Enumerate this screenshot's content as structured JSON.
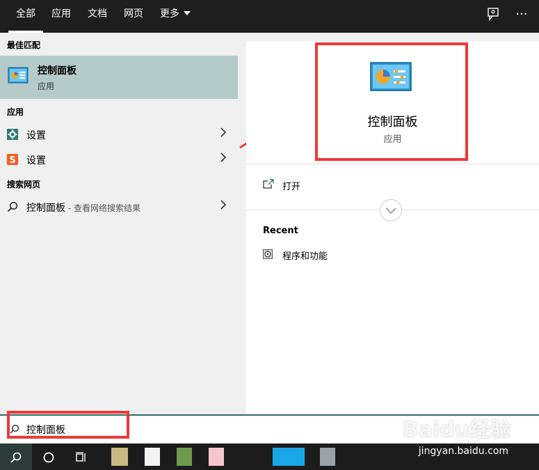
{
  "tabs": [
    {
      "label": "全部",
      "active": true
    },
    {
      "label": "应用"
    },
    {
      "label": "文档"
    },
    {
      "label": "网页"
    },
    {
      "label": "更多"
    }
  ],
  "top_icons": {
    "feedback": "feedback-icon",
    "more": "···"
  },
  "left": {
    "best_match_header": "最佳匹配",
    "best_match": {
      "name": "控制面板",
      "type": "应用",
      "icon": "control-panel-icon"
    },
    "apps_header": "应用",
    "apps": [
      {
        "label": "设置",
        "icon": "gear-icon"
      },
      {
        "label": "设置",
        "icon": "sogou-settings-icon"
      }
    ],
    "web_header": "搜索网页",
    "web_result": {
      "label": "控制面板",
      "sub": " - 查看网络搜索结果",
      "icon": "search-icon"
    }
  },
  "right": {
    "app_title": "控制面板",
    "app_type": "应用",
    "open_label": "打开",
    "recent_header": "Recent",
    "recent_items": [
      {
        "label": "程序和功能",
        "icon": "programs-features-icon"
      }
    ]
  },
  "search": {
    "value": "控制面板"
  },
  "watermark": {
    "brand": "Baidu经验",
    "url": "jingyan.baidu.com"
  },
  "colors": {
    "accent_red": "#ef3838",
    "selection": "#b5cbc9",
    "topbar": "#1e1e1e"
  }
}
